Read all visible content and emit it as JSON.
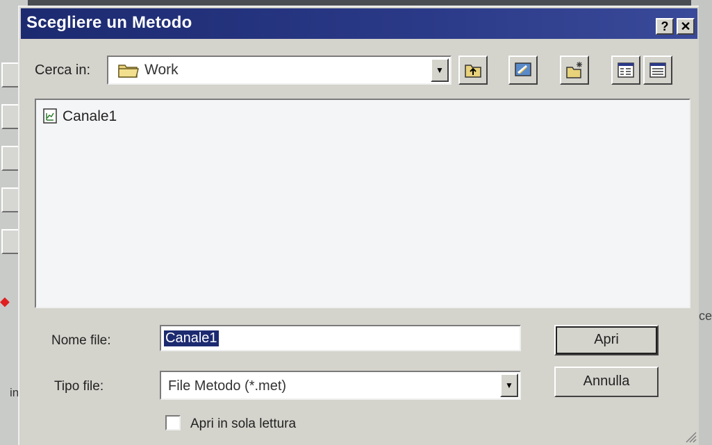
{
  "background": {
    "left_text": "in)",
    "right_text": "ce"
  },
  "dialog": {
    "title": "Scegliere un Metodo",
    "help_label": "?",
    "close_label": "✕",
    "look_in": {
      "label": "Cerca in:",
      "value": "Work"
    },
    "toolbar": {
      "icons": [
        "up-one-level-icon",
        "desktop-icon",
        "new-folder-icon",
        "list-view-icon",
        "details-view-icon"
      ]
    },
    "files": [
      {
        "name": "Canale1",
        "icon": "method-file-icon"
      }
    ],
    "file_name": {
      "label": "Nome file:",
      "value": "Canale1"
    },
    "file_type": {
      "label": "Tipo file:",
      "value": "File Metodo (*.met)"
    },
    "buttons": {
      "open": "Apri",
      "cancel": "Annulla"
    },
    "readonly": {
      "label": "Apri in sola lettura",
      "checked": false
    },
    "colors": {
      "titlebar": "#1c2a70",
      "face": "#d4d3cc",
      "selection": "#1c2a70"
    }
  }
}
